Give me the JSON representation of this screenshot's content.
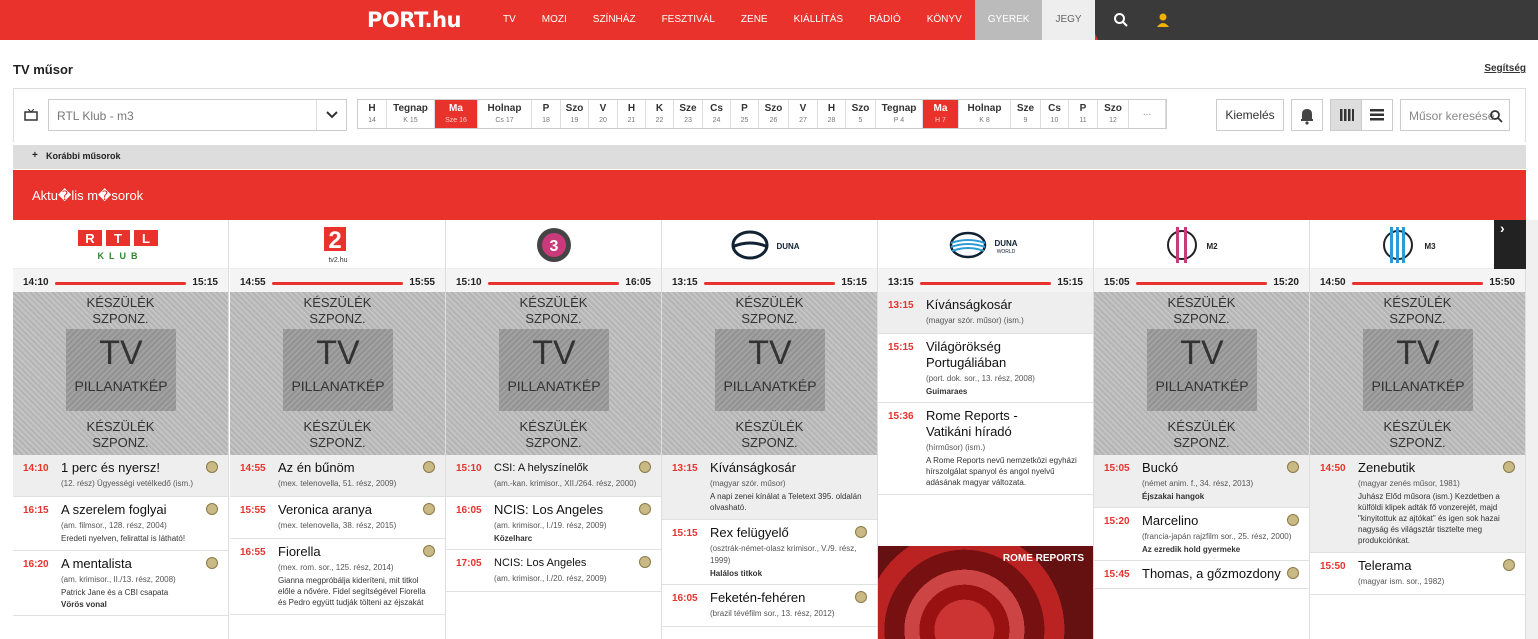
{
  "nav": {
    "logo": "PORT.hu",
    "items": [
      "TV",
      "MOZI",
      "SZÍNHÁZ",
      "FESZTIVÁL",
      "ZENE",
      "KIÁLLÍTÁS",
      "RÁDIÓ",
      "KÖNYV",
      "GYEREK",
      "JEGY"
    ]
  },
  "page": {
    "title": "TV műsor",
    "help": "Segítség"
  },
  "controls": {
    "channel_select": "RTL Klub - m3",
    "days": [
      {
        "l": "H",
        "d": "14"
      },
      {
        "l": "Tegnap",
        "d": "K 15"
      },
      {
        "l": "Ma",
        "d": "Sze 16"
      },
      {
        "l": "Holnap",
        "d": "Cs 17"
      },
      {
        "l": "P",
        "d": "18"
      },
      {
        "l": "Szo",
        "d": "19"
      },
      {
        "l": "V",
        "d": "20"
      },
      {
        "l": "H",
        "d": "21"
      },
      {
        "l": "K",
        "d": "22"
      },
      {
        "l": "Sze",
        "d": "23"
      },
      {
        "l": "Cs",
        "d": "24"
      },
      {
        "l": "P",
        "d": "25"
      },
      {
        "l": "Szo",
        "d": "26"
      },
      {
        "l": "V",
        "d": "27"
      },
      {
        "l": "H",
        "d": "28"
      },
      {
        "l": "Szo",
        "d": "5"
      },
      {
        "l": "Tegnap",
        "d": "P 4"
      },
      {
        "l": "Ma",
        "d": "H 7"
      },
      {
        "l": "Holnap",
        "d": "K 8"
      },
      {
        "l": "Sze",
        "d": "9"
      },
      {
        "l": "Cs",
        "d": "10"
      },
      {
        "l": "P",
        "d": "11"
      },
      {
        "l": "Szo",
        "d": "12"
      }
    ],
    "more": "...",
    "highlight": "Kiemelés",
    "search_placeholder": "Műsor keresése"
  },
  "earlier": "Korábbi műsorok",
  "banner": "Aktu�lis m�sorok",
  "snapshot": {
    "line1": "KÉSZÜLÉK",
    "line2": "SZPONZ.",
    "tv": "TV",
    "pk": "PILLANATKÉP"
  },
  "channels": [
    {
      "logo": "RTL KLUB",
      "start": "14:10",
      "end": "15:15",
      "programs": [
        {
          "time": "14:10",
          "name": "1 perc és nyersz!",
          "desc": "(12. rész) Ügyességi vetélkedő (ism.)"
        },
        {
          "time": "16:15",
          "name": "A szerelem foglyai",
          "desc": "(am. filmsor., 128. rész, 2004)",
          "extra": "Eredeti nyelven, felirattal is látható!"
        },
        {
          "time": "16:20",
          "name": "A mentalista",
          "desc": "(am. krimisor., II./13. rész, 2008)",
          "bold": "Vörös vonal",
          "extra": "Patrick Jane és a CBI csapata"
        }
      ]
    },
    {
      "logo": "tv2.hu",
      "start": "14:55",
      "end": "15:55",
      "programs": [
        {
          "time": "14:55",
          "name": "Az én bűnöm",
          "desc": "(mex. telenovella, 51. rész, 2009)"
        },
        {
          "time": "15:55",
          "name": "Veronica aranya",
          "desc": "(mex. telenovella, 38. rész, 2015)"
        },
        {
          "time": "16:55",
          "name": "Fiorella",
          "desc": "(mex. rom. sor., 125. rész, 2014)",
          "extra": "Gianna megpróbálja kideríteni, mit titkol előle a nővére. Fidel segítségével Fiorella és Pedro együtt tudják tölteni az éjszakát"
        }
      ]
    },
    {
      "logo": "3",
      "start": "15:10",
      "end": "16:05",
      "programs": [
        {
          "time": "15:10",
          "name": "CSI: A helyszínelők",
          "small": true,
          "desc": "(am.-kan. krimisor., XII./264. rész, 2000)"
        },
        {
          "time": "16:05",
          "name": "NCIS: Los Angeles",
          "desc": "(am. krimisor., I./19. rész, 2009)",
          "bold": "Közelharc"
        },
        {
          "time": "17:05",
          "name": "NCIS: Los Angeles",
          "small": true,
          "desc": "(am. krimisor., I./20. rész, 2009)"
        }
      ]
    },
    {
      "logo": "DUNA",
      "start": "13:15",
      "end": "15:15",
      "programs": [
        {
          "time": "13:15",
          "name": "Kívánságkosár",
          "desc": "(magyar szór. műsor)",
          "extra": "A napi zenei kínálat a Teletext 395. oldalán olvasható."
        },
        {
          "time": "15:15",
          "name": "Rex felügyelő",
          "desc": "(osztrák-német-olasz krimisor., V./9. rész, 1999)",
          "bold": "Halálos titkok"
        },
        {
          "time": "16:05",
          "name": "Feketén-fehéren",
          "desc": "(brazil tévéfilm sor., 13. rész, 2012)"
        }
      ]
    },
    {
      "logo": "DUNA WORLD",
      "start": "13:15",
      "end": "15:15",
      "programs": [
        {
          "time": "13:15",
          "name": "Kívánságkosár",
          "desc": "(magyar szór. műsor) (ism.)"
        },
        {
          "time": "15:15",
          "name": "Világörökség Portugáliában",
          "desc": "(port. dok. sor., 13. rész, 2008)",
          "bold": "Guimaraes"
        },
        {
          "time": "15:36",
          "name": "Rome Reports - Vatikáni híradó",
          "desc": "(hírműsor) (ism.)",
          "extra": "A Rome Reports nevű nemzetközi egyházi hírszolgálat spanyol és angol nyelvű adásának magyar változata."
        }
      ],
      "image_label": "ROME REPORTS"
    },
    {
      "logo": "M2",
      "start": "15:05",
      "end": "15:20",
      "programs": [
        {
          "time": "15:05",
          "name": "Buckó",
          "desc": "(német anim. f., 34. rész, 2013)",
          "bold": "Éjszakai hangok"
        },
        {
          "time": "15:20",
          "name": "Marcelino",
          "desc": "(francia-japán rajzfilm sor., 25. rész, 2000)",
          "bold": "Az ezredik hold gyermeke"
        },
        {
          "time": "15:45",
          "name": "Thomas, a gőzmozdony",
          "desc": ""
        }
      ]
    },
    {
      "logo": "M3",
      "start": "14:50",
      "end": "15:50",
      "programs": [
        {
          "time": "14:50",
          "name": "Zenebutik",
          "desc": "(magyar zenés műsor, 1981)",
          "extra": "Juhász Előd műsora (ism.) Kezdetben a külföldi klipek adták fő vonzerejét, majd \"kinyitottuk az ajtókat\" és igen sok hazai nagyság és világsztár tisztelte meg produkciónkat."
        },
        {
          "time": "15:50",
          "name": "Telerama",
          "desc": "(magyar ism. sor., 1982)"
        }
      ]
    }
  ]
}
